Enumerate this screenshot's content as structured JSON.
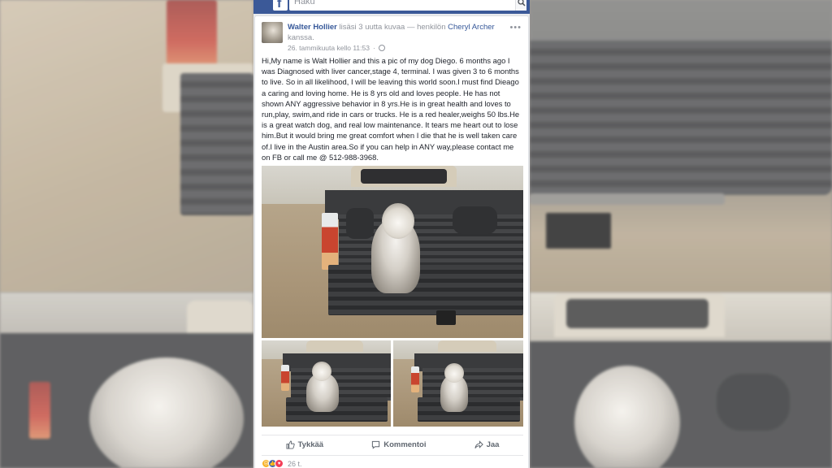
{
  "header": {
    "search_placeholder": "Haku",
    "logo_letter": "f"
  },
  "post": {
    "author": "Walter Hollier",
    "action_text": "lisäsi 3 uutta kuvaa — henkilön",
    "tagged": "Cheryl Archer",
    "tagged_suffix": "kanssa.",
    "timestamp": "26. tammikuuta kello 11:53",
    "separator": "·",
    "text": "Hi,My name is Walt Hollier and this a pic of my dog Diego. 6 months ago I was Diagnosed with liver cancer,stage 4, terminal. I was given 3 to 6 months to live. So in all likelihood, I will be leaving this world soon.I must find Dieago a caring and loving home. He is 8 yrs old and loves people. He has not shown ANY aggressive behavior in 8 yrs.He is in great health and loves to run,play, swim,and ride in cars or trucks. He is a red healer,weighs 50 lbs.He is a great watch dog, and real low maintenance. It tears me heart out to lose him.But it would bring me great comfort when I die that he is well taken care of.I live in the Austin area.So if you can help in ANY way,please contact me on FB or call me @ 512-988-3968."
  },
  "actions": {
    "like": "Tykkää",
    "comment": "Kommentoi",
    "share": "Jaa"
  },
  "reactions": {
    "count": "26 t."
  },
  "colors": {
    "facebook_blue": "#3b5998",
    "link_blue": "#365899",
    "text": "#1d2129",
    "muted": "#90949c"
  }
}
